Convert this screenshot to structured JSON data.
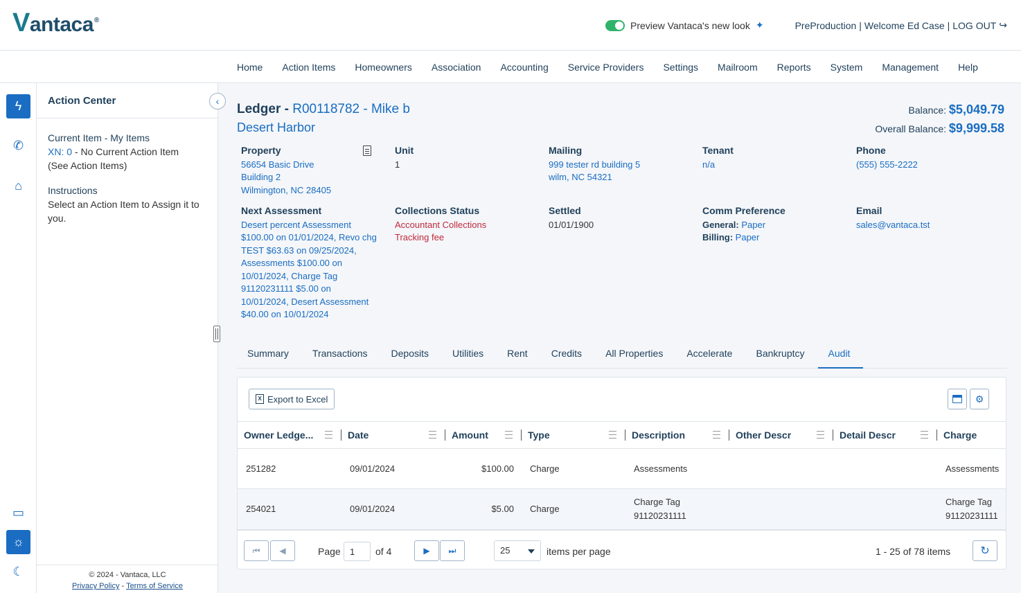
{
  "header": {
    "logo": "Vantaca",
    "preview_label": "Preview Vantaca's new look",
    "environment": "PreProduction",
    "welcome": "Welcome Ed Case",
    "logout": "LOG OUT"
  },
  "nav": [
    "Home",
    "Action Items",
    "Homeowners",
    "Association",
    "Accounting",
    "Service Providers",
    "Settings",
    "Mailroom",
    "Reports",
    "System",
    "Management",
    "Help"
  ],
  "action_center": {
    "title": "Action Center",
    "current_label": "Current Item - My Items",
    "xn_label": "XN: 0",
    "xn_text": " - No Current Action Item",
    "see_items": "(See Action Items)",
    "instructions_label": "Instructions",
    "instructions_text": "Select an Action Item to Assign it to you.",
    "copyright": "© 2024 - Vantaca, LLC",
    "privacy": "Privacy Policy",
    "terms": "Terms of Service"
  },
  "ledger": {
    "title_prefix": "Ledger - ",
    "account": "R00118782 - Mike b",
    "community": "Desert Harbor",
    "balance_label": "Balance:",
    "balance": "$5,049.79",
    "overall_label": "Overall Balance:",
    "overall": "$9,999.58"
  },
  "info": {
    "property": {
      "label": "Property",
      "line1": "56654 Basic Drive",
      "line2": "Building 2",
      "line3": "Wilmington, NC 28405"
    },
    "unit": {
      "label": "Unit",
      "value": "1"
    },
    "mailing": {
      "label": "Mailing",
      "line1": "999 tester rd building 5",
      "line2": "wilm, NC 54321"
    },
    "tenant": {
      "label": "Tenant",
      "value": "n/a"
    },
    "phone": {
      "label": "Phone",
      "value": "(555) 555-2222"
    },
    "next_assessment": {
      "label": "Next Assessment",
      "value": "Desert percent Assessment $100.00 on 01/01/2024, Revo chg TEST $63.63 on 09/25/2024, Assessments $100.00 on 10/01/2024, Charge Tag 91120231111 $5.00 on 10/01/2024, Desert Assessment $40.00 on 10/01/2024"
    },
    "collections": {
      "label": "Collections Status",
      "line1": "Accountant Collections",
      "line2": "Tracking fee"
    },
    "settled": {
      "label": "Settled",
      "value": "01/01/1900"
    },
    "comm": {
      "label": "Comm Preference",
      "general_label": "General:",
      "general": "Paper",
      "billing_label": "Billing:",
      "billing": "Paper"
    },
    "email": {
      "label": "Email",
      "value": "sales@vantaca.tst"
    }
  },
  "tabs": [
    "Summary",
    "Transactions",
    "Deposits",
    "Utilities",
    "Rent",
    "Credits",
    "All Properties",
    "Accelerate",
    "Bankruptcy",
    "Audit"
  ],
  "grid": {
    "export_label": "Export to Excel",
    "columns": [
      "Owner Ledge...",
      "Date",
      "Amount",
      "Type",
      "Description",
      "Other Descr",
      "Detail Descr",
      "Charge"
    ],
    "rows": [
      {
        "ledger": "251282",
        "date": "09/01/2024",
        "amount": "$100.00",
        "type": "Charge",
        "description": "Assessments",
        "other": "",
        "detail": "",
        "charge": "Assessments"
      },
      {
        "ledger": "254021",
        "date": "09/01/2024",
        "amount": "$5.00",
        "type": "Charge",
        "description": "Charge Tag 91120231111",
        "other": "",
        "detail": "",
        "charge": "Charge Tag 91120231111"
      }
    ],
    "pager": {
      "page_label": "Page",
      "page": "1",
      "of_label": "of 4",
      "page_size": "25",
      "per_page_label": "items per page",
      "summary": "1 - 25 of 78 items"
    }
  }
}
